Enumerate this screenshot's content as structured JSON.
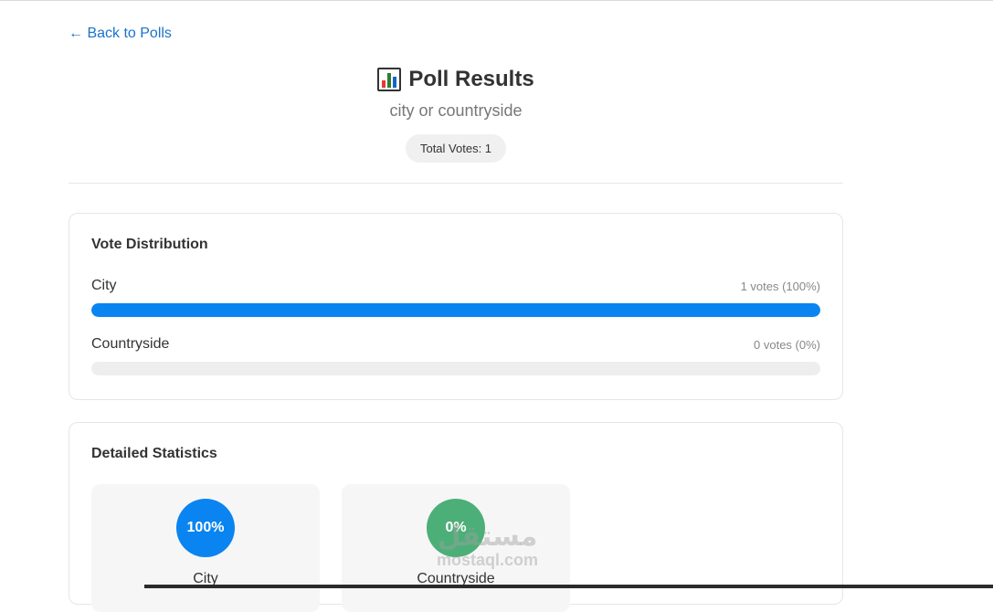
{
  "nav": {
    "back_label": "← Back to Polls"
  },
  "header": {
    "icon": "bar-chart-icon",
    "title": "Poll Results",
    "question": "city or countryside",
    "total_votes": "Total Votes: 1"
  },
  "distribution": {
    "title": "Vote Distribution",
    "options": [
      {
        "label": "City",
        "count_text": "1 votes (100%)",
        "percent": 100
      },
      {
        "label": "Countryside",
        "count_text": "0 votes (0%)",
        "percent": 0
      }
    ]
  },
  "statistics": {
    "title": "Detailed Statistics",
    "items": [
      {
        "percent_text": "100%",
        "label": "City",
        "color": "#0a84f0"
      },
      {
        "percent_text": "0%",
        "label": "Countryside",
        "color": "#4caf78"
      }
    ]
  },
  "watermark": {
    "arabic": "مستقل",
    "latin": "mostaql.com"
  },
  "colors": {
    "link": "#1a73c8",
    "bar_fill": "#0a84f0",
    "bar_track": "#eeeeee"
  }
}
